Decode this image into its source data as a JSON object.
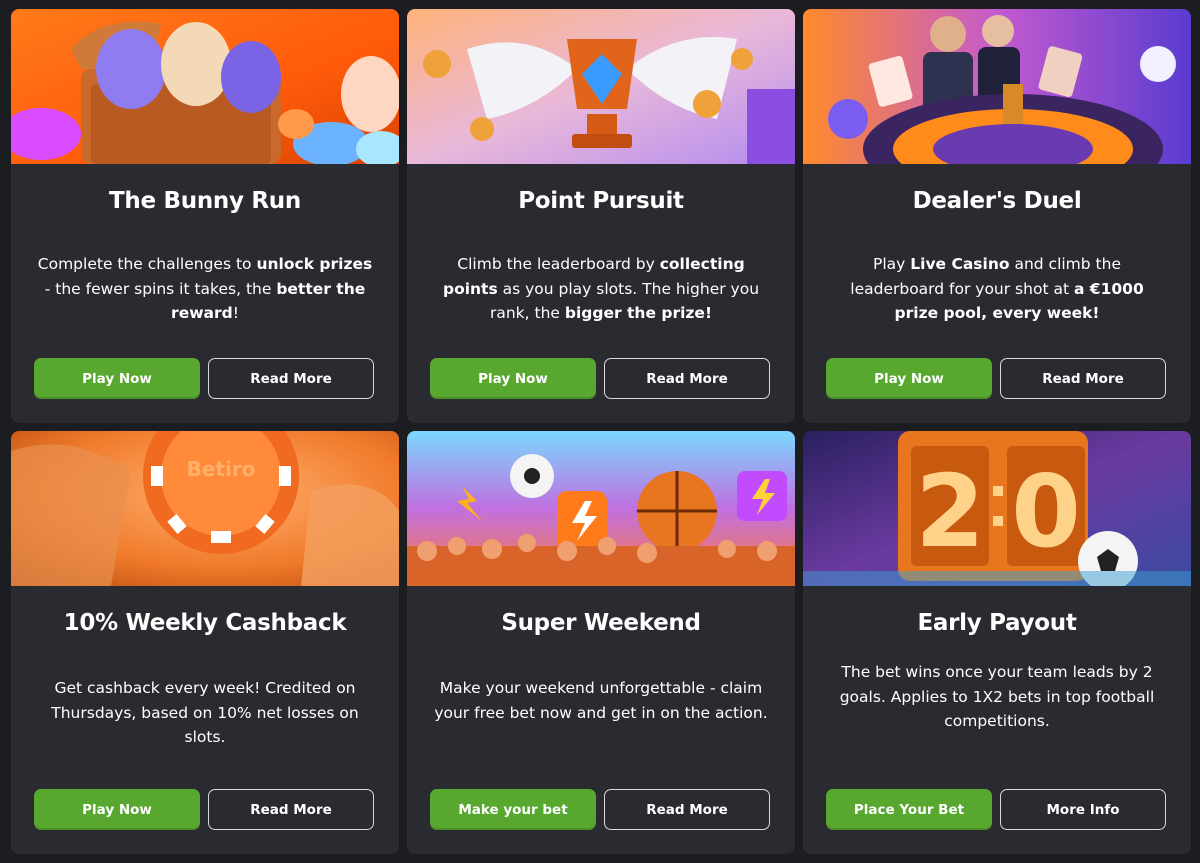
{
  "cards": [
    {
      "title": "The Bunny Run",
      "desc": [
        {
          "t": "Complete the challenges to ",
          "b": false
        },
        {
          "t": "unlock prizes",
          "b": true
        },
        {
          "t": " - the fewer spins it takes, the ",
          "b": false
        },
        {
          "t": "better the reward",
          "b": true
        },
        {
          "t": "!",
          "b": false
        }
      ],
      "primary": "Play Now",
      "secondary": "Read More",
      "art": "easter-eggs-chest-art"
    },
    {
      "title": "Point Pursuit",
      "desc": [
        {
          "t": "Climb the leaderboard by ",
          "b": false
        },
        {
          "t": "collecting points",
          "b": true
        },
        {
          "t": " as you play slots. The higher you rank, the ",
          "b": false
        },
        {
          "t": "bigger the prize!",
          "b": true
        }
      ],
      "primary": "Play Now",
      "secondary": "Read More",
      "art": "winged-trophy-art"
    },
    {
      "title": "Dealer's Duel",
      "desc": [
        {
          "t": "Play ",
          "b": false
        },
        {
          "t": "Live Casino",
          "b": true
        },
        {
          "t": " and climb the leaderboard for your shot at ",
          "b": false
        },
        {
          "t": "a €1000 prize pool, every week!",
          "b": true
        }
      ],
      "primary": "Play Now",
      "secondary": "Read More",
      "art": "live-casino-roulette-art"
    },
    {
      "title": "10% Weekly Cashback",
      "desc": [
        {
          "t": "Get cashback every week! Credited on Thursdays, based on 10% net losses on slots.",
          "b": false
        }
      ],
      "primary": "Play Now",
      "secondary": "Read More",
      "art": "betiro-chip-art",
      "chip_text": "Betiro"
    },
    {
      "title": "Super Weekend",
      "desc": [
        {
          "t": "Make your weekend unforgettable - claim your free bet now and get in on the action.",
          "b": false
        }
      ],
      "primary": "Make your bet",
      "secondary": "Read More",
      "art": "sports-crowd-art"
    },
    {
      "title": "Early Payout",
      "desc": [
        {
          "t": "The bet wins once your team leads by 2 goals. Applies to 1X2 bets in top football competitions.",
          "b": false
        }
      ],
      "primary": "Place Your Bet",
      "secondary": "More Info",
      "art": "scoreboard-art",
      "score_left": "2",
      "score_right": "0"
    }
  ],
  "colors": {
    "page_bg": "#1c1d21",
    "card_bg": "#2a2b30",
    "primary_button": "#58a82f",
    "secondary_border": "#d9d9d9",
    "text": "#ffffff"
  }
}
